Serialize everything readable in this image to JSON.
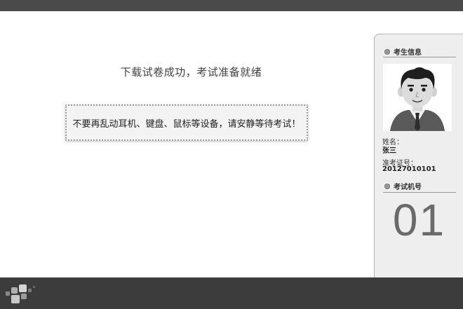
{
  "main": {
    "status_title": "下载试卷成功，考试准备就绪",
    "notice": "不要再乱动耳机、键盘、鼠标等设备，请安静等待考试！"
  },
  "sidebar": {
    "candidate_info_header": "考生信息",
    "name_label": "姓名：",
    "name_value": "张三",
    "exam_id_label": "准考证号：",
    "exam_id_value": "20127010101",
    "machine_header": "考试机号",
    "machine_number": "01"
  },
  "colors": {
    "top_bar": "#4a4a4a",
    "bottom_bar": "#3c3c3c",
    "side_panel": "#eeeeee",
    "machine_number": "#6a6a6a"
  },
  "icons": [
    "section-dot-icon",
    "candidate-avatar",
    "app-logo-icon"
  ]
}
